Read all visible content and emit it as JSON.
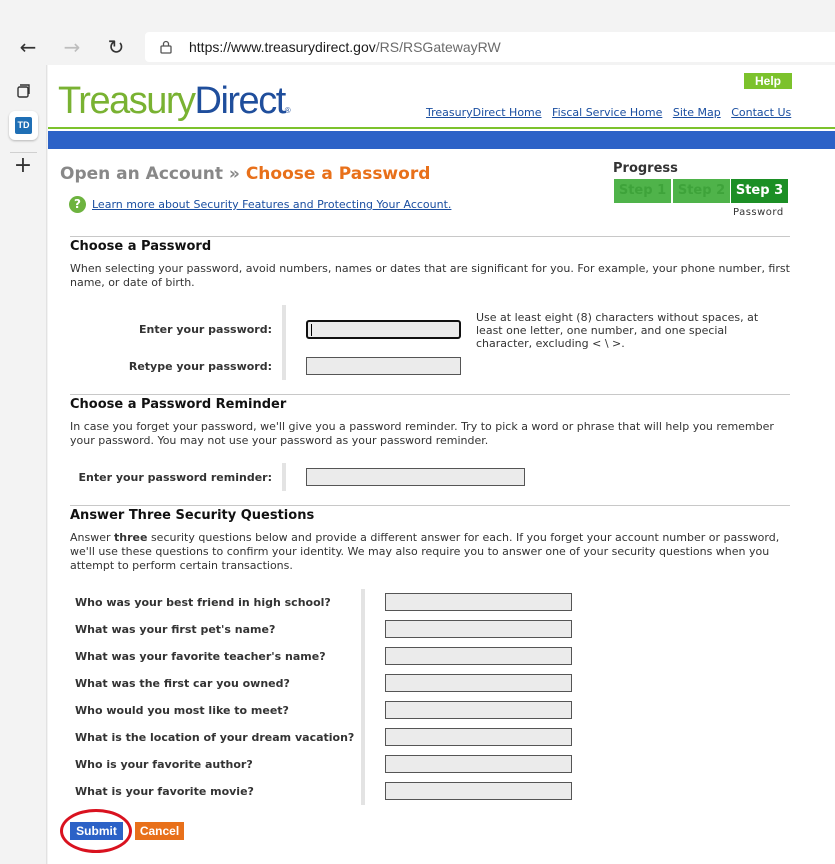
{
  "browser": {
    "url_host": "https://www.treasurydirect.gov",
    "url_path": "/RS/RSGatewayRW",
    "tab_icon": "TD"
  },
  "header": {
    "logo_part1": "Treasury",
    "logo_part2": "Direct",
    "logo_reg": "®",
    "help": "Help",
    "links": [
      "TreasuryDirect Home",
      "Fiscal Service Home",
      "Site Map",
      "Contact Us"
    ]
  },
  "breadcrumb": {
    "parent": "Open an Account",
    "sep": "»",
    "current": "Choose a Password"
  },
  "learn_more": "Learn more about Security Features and Protecting Your Account.",
  "progress": {
    "label": "Progress",
    "steps": [
      "Step 1",
      "Step 2",
      "Step 3"
    ],
    "current_step_label": "Password"
  },
  "password_section": {
    "heading": "Choose a Password",
    "intro": "When selecting your password, avoid numbers, names or dates that are significant for you. For example, your phone number, first name, or date of birth.",
    "enter_label": "Enter your password:",
    "retype_label": "Retype your password:",
    "hint": "Use at least eight (8) characters without spaces, at least one letter, one number, and one special character, excluding < \\ >."
  },
  "reminder_section": {
    "heading": "Choose a Password Reminder",
    "intro": "In case you forget your password, we'll give you a password reminder. Try to pick a word or phrase that will help you remember your password. You may not use your password as your password reminder.",
    "label": "Enter your password reminder:"
  },
  "questions_section": {
    "heading": "Answer Three Security Questions",
    "intro_before": "Answer ",
    "intro_bold": "three",
    "intro_after": " security questions below and provide a different answer for each. If you forget your account number or password, we'll use these questions to confirm your identity. We may also require you to answer one of your security questions when you attempt to perform certain transactions.",
    "questions": [
      "Who was your best friend in high school?",
      "What was your first pet's name?",
      "What was your favorite teacher's name?",
      "What was the first car you owned?",
      "Who would you most like to meet?",
      "What is the location of your dream vacation?",
      "Who is your favorite author?",
      "What is your favorite movie?"
    ]
  },
  "actions": {
    "submit": "Submit",
    "cancel": "Cancel"
  },
  "colors": {
    "brand_green": "#7cc22c",
    "brand_blue": "#2c62c7",
    "accent_orange": "#e8701a",
    "annotation_red": "#d9121f"
  }
}
